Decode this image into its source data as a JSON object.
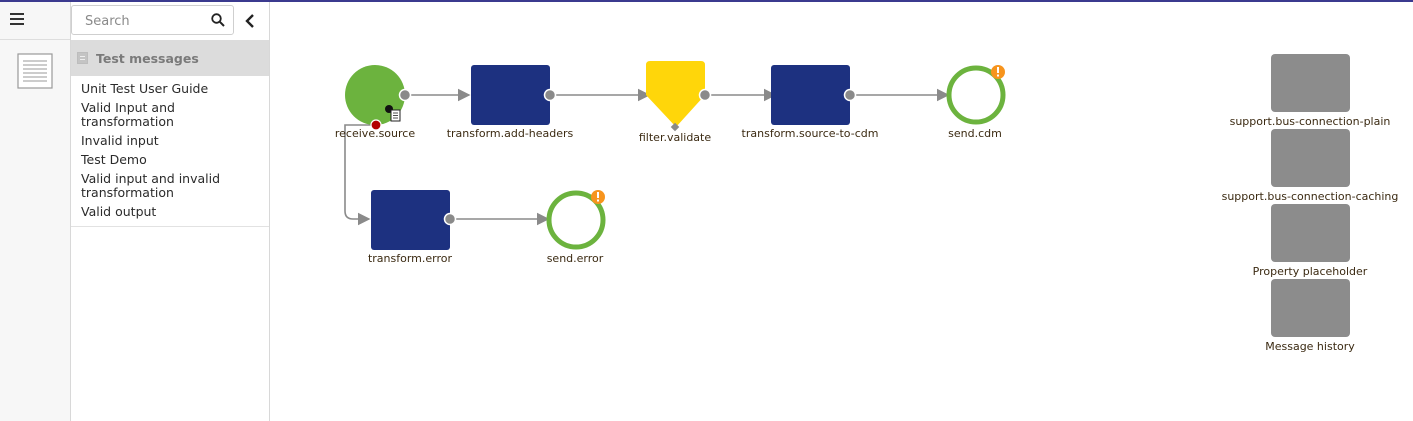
{
  "search": {
    "placeholder": "Search"
  },
  "sidebar": {
    "section_title": "Test messages",
    "items": [
      {
        "label": "Unit Test User Guide"
      },
      {
        "label": "Valid Input and transformation"
      },
      {
        "label": "Invalid input"
      },
      {
        "label": "Test Demo"
      },
      {
        "label": "Valid input and invalid transformation"
      },
      {
        "label": "Valid output"
      }
    ]
  },
  "flow": {
    "receive_source": "receive.source",
    "transform_add_headers": "transform.add-headers",
    "filter_validate": "filter.validate",
    "transform_source_to_cdm": "transform.source-to-cdm",
    "send_cdm": "send.cdm",
    "transform_error": "transform.error",
    "send_error": "send.error"
  },
  "support": [
    {
      "label": "support.bus-connection-plain"
    },
    {
      "label": "support.bus-connection-caching"
    },
    {
      "label": "Property placeholder"
    },
    {
      "label": "Message history"
    }
  ],
  "colors": {
    "receive": "#6cb33e",
    "transform": "#1d3180",
    "filter": "#ffd60a",
    "send_ring": "#6cb33e",
    "warning": "#f7941d",
    "support": "#8c8c8c",
    "topbar": "#3b3a8f"
  },
  "icons": [
    "hamburger-menu-icon",
    "document-icon",
    "search-icon",
    "chevron-left-icon",
    "warning-icon",
    "attachment-icon"
  ]
}
